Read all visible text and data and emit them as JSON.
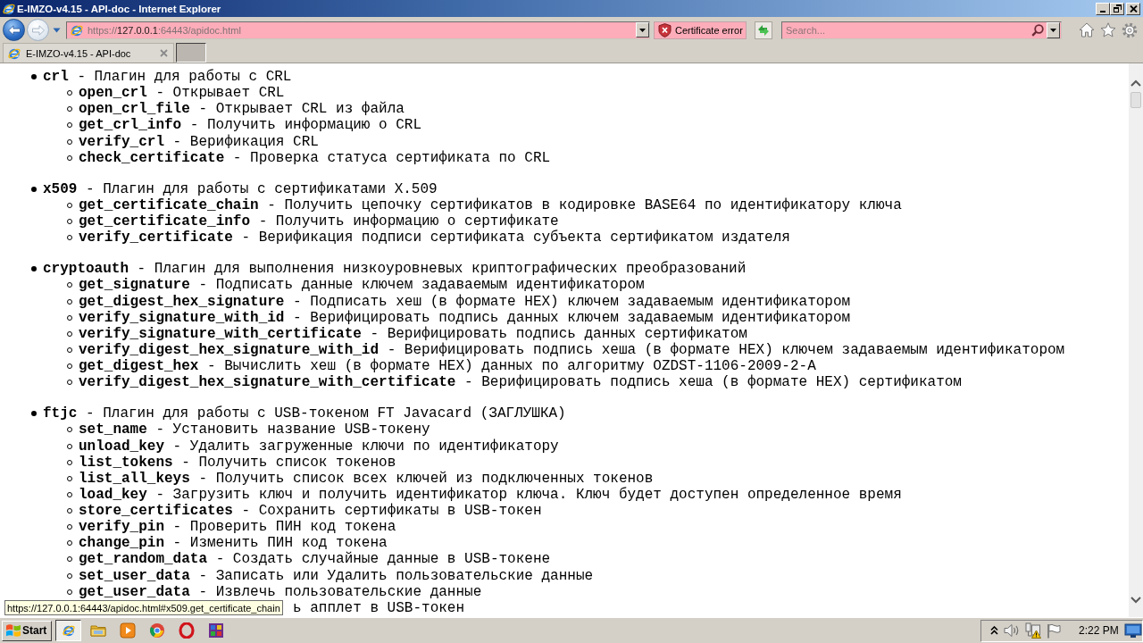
{
  "window": {
    "title": "E-IMZO-v4.15 - API-doc - Internet Explorer"
  },
  "navigation": {
    "back": {
      "disabled": false
    },
    "forward": {
      "disabled": true
    }
  },
  "address_bar": {
    "scheme": "https://",
    "host": "127.0.0.1",
    "path": ":64443/apidoc.html"
  },
  "certificate_error": "Certificate error",
  "search": {
    "placeholder": "Search..."
  },
  "tabs": [
    {
      "label": "E-IMZO-v4.15 - API-doc",
      "selected": true
    }
  ],
  "plugins": [
    {
      "name": "crl",
      "desc": "- Плагин для работы с CRL",
      "methods": [
        {
          "name": "open_crl",
          "desc": "- Открывает CRL"
        },
        {
          "name": "open_crl_file",
          "desc": "- Открывает CRL из файла"
        },
        {
          "name": "get_crl_info",
          "desc": "- Получить информацию о CRL"
        },
        {
          "name": "verify_crl",
          "desc": "- Верификация CRL"
        },
        {
          "name": "check_certificate",
          "desc": "- Проверка статуса сертификата по CRL"
        }
      ]
    },
    {
      "name": "x509",
      "desc": "- Плагин для работы с сертификатами X.509",
      "methods": [
        {
          "name": "get_certificate_chain",
          "desc": "- Получить цепочку сертификатов в кодировке BASE64 по идентификатору ключа"
        },
        {
          "name": "get_certificate_info",
          "desc": "- Получить информацию о сертификате"
        },
        {
          "name": "verify_certificate",
          "desc": "- Верификация подписи сертификата субъекта сертификатом издателя"
        }
      ]
    },
    {
      "name": "cryptoauth",
      "desc": "- Плагин для выполнения низкоуровневых криптографических преобразований",
      "methods": [
        {
          "name": "get_signature",
          "desc": "- Подписать данные ключем задаваемым идентификатором"
        },
        {
          "name": "get_digest_hex_signature",
          "desc": "- Подписать хеш (в формате HEX) ключем задаваемым идентификатором"
        },
        {
          "name": "verify_signature_with_id",
          "desc": "- Верифицировать подпись данных ключем задаваемым идентификатором"
        },
        {
          "name": "verify_signature_with_certificate",
          "desc": "- Верифицировать подпись данных сертификатом"
        },
        {
          "name": "verify_digest_hex_signature_with_id",
          "desc": "- Верифицировать подпись хеша (в формате HEX) ключем задаваемым идентификатором"
        },
        {
          "name": "get_digest_hex",
          "desc": "- Вычислить хеш (в формате HEX) данных по алгоритму OZDST-1106-2009-2-A"
        },
        {
          "name": "verify_digest_hex_signature_with_certificate",
          "desc": "- Верифицировать подпись хеша (в формате HEX) сертификатом"
        }
      ]
    },
    {
      "name": "ftjc",
      "desc": "- Плагин для работы с USB-токеном FT Javacard (ЗАГЛУШКА)",
      "methods": [
        {
          "name": "set_name",
          "desc": "- Установить название USB-токену"
        },
        {
          "name": "unload_key",
          "desc": "- Удалить загруженные ключи по идентификатору"
        },
        {
          "name": "list_tokens",
          "desc": "- Получить список токенов"
        },
        {
          "name": "list_all_keys",
          "desc": "- Получить список всех ключей из подключенных токенов"
        },
        {
          "name": "load_key",
          "desc": "- Загрузить ключ и получить идентификатор ключа. Ключ будет доступен определенное время"
        },
        {
          "name": "store_certificates",
          "desc": "- Сохранить сертификаты в USB-токен"
        },
        {
          "name": "verify_pin",
          "desc": "- Проверить ПИН код токена"
        },
        {
          "name": "change_pin",
          "desc": "- Изменить ПИН код токена"
        },
        {
          "name": "get_random_data",
          "desc": "- Создать случайные данные в USB-токене"
        },
        {
          "name": "set_user_data",
          "desc": "- Записать или Удалить пользовательские данные"
        },
        {
          "name": "get_user_data",
          "desc": "- Извлечь пользовательские данные"
        },
        {
          "desc": "ь апплет в USB-токен"
        }
      ]
    }
  ],
  "link_tooltip": "https://127.0.0.1:64443/apidoc.html#x509.get_certificate_chain",
  "taskbar": {
    "start": "Start",
    "apps": [
      {
        "kind": "browser",
        "selected": true
      },
      {
        "kind": "folder",
        "selected": false
      },
      {
        "kind": "player",
        "selected": false
      },
      {
        "kind": "wheel",
        "selected": false
      },
      {
        "kind": "ring",
        "selected": false
      },
      {
        "kind": "blocks",
        "selected": false
      }
    ],
    "clock": "2:22 PM"
  }
}
